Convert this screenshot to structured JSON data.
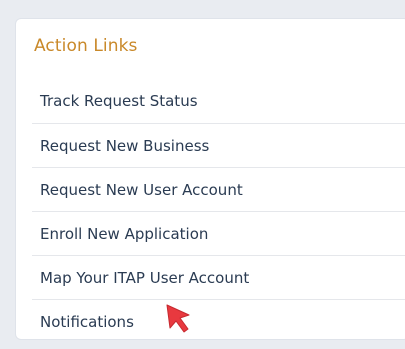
{
  "panel": {
    "title": "Action Links",
    "links": [
      {
        "label": "Track Request Status"
      },
      {
        "label": "Request New Business"
      },
      {
        "label": "Request New User Account"
      },
      {
        "label": "Enroll New Application"
      },
      {
        "label": "Map Your ITAP User Account"
      },
      {
        "label": "Notifications"
      }
    ]
  },
  "colors": {
    "title": "#c9892a",
    "link_text": "#2a3b52",
    "cursor": "#e8393f"
  },
  "pointer": {
    "icon": "arrow-cursor-icon"
  }
}
